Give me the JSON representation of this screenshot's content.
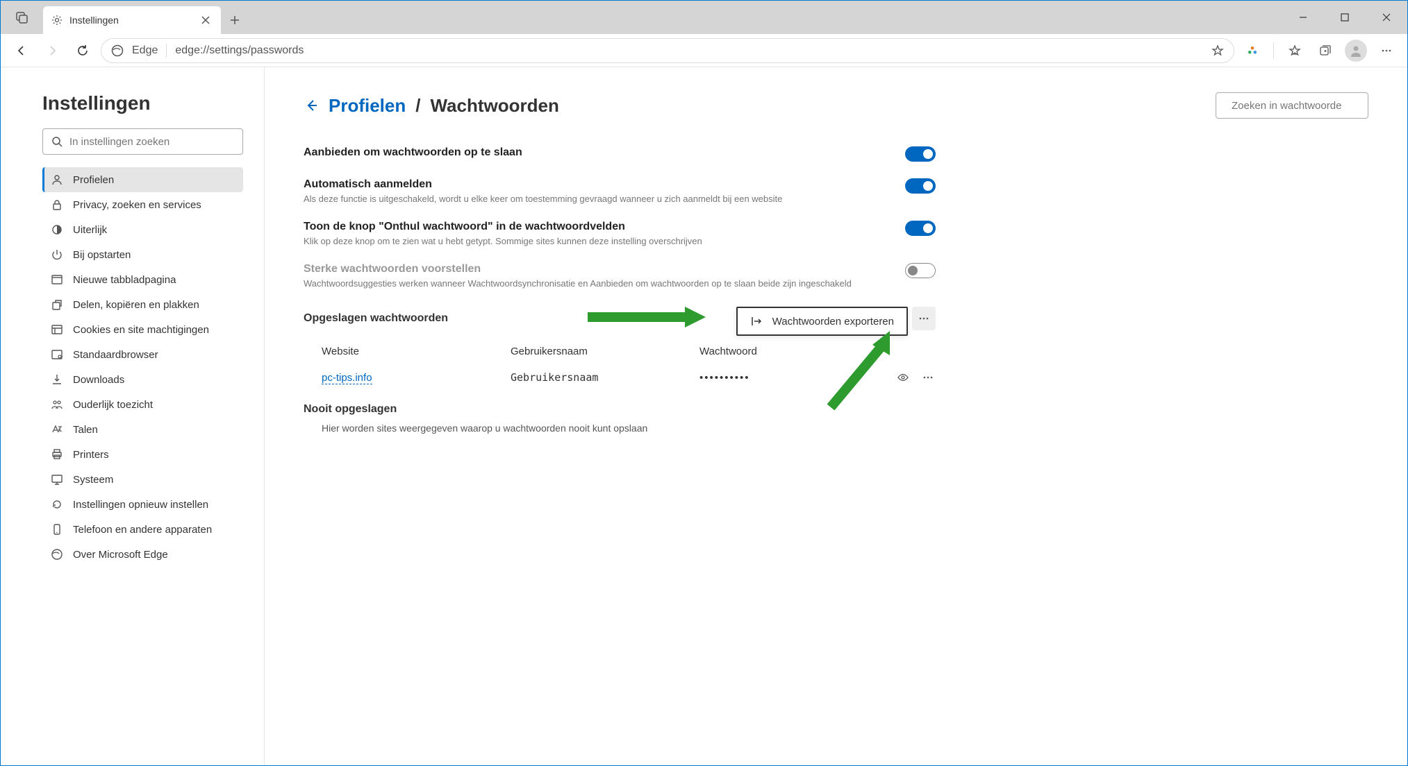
{
  "window": {
    "tab_title": "Instellingen"
  },
  "address": {
    "label": "Edge",
    "url": "edge://settings/passwords"
  },
  "sidebar": {
    "title": "Instellingen",
    "search_placeholder": "In instellingen zoeken",
    "items": [
      {
        "label": "Profielen",
        "icon": "profile"
      },
      {
        "label": "Privacy, zoeken en services",
        "icon": "lock"
      },
      {
        "label": "Uiterlijk",
        "icon": "appearance"
      },
      {
        "label": "Bij opstarten",
        "icon": "power"
      },
      {
        "label": "Nieuwe tabbladpagina",
        "icon": "newtab"
      },
      {
        "label": "Delen, kopiëren en plakken",
        "icon": "share"
      },
      {
        "label": "Cookies en site machtigingen",
        "icon": "cookies"
      },
      {
        "label": "Standaardbrowser",
        "icon": "browser"
      },
      {
        "label": "Downloads",
        "icon": "download"
      },
      {
        "label": "Ouderlijk toezicht",
        "icon": "family"
      },
      {
        "label": "Talen",
        "icon": "language"
      },
      {
        "label": "Printers",
        "icon": "printer"
      },
      {
        "label": "Systeem",
        "icon": "system"
      },
      {
        "label": "Instellingen opnieuw instellen",
        "icon": "reset"
      },
      {
        "label": "Telefoon en andere apparaten",
        "icon": "phone"
      },
      {
        "label": "Over Microsoft Edge",
        "icon": "edge"
      }
    ]
  },
  "breadcrumb": {
    "parent": "Profielen",
    "current": "Wachtwoorden"
  },
  "page_search_placeholder": "Zoeken in wachtwoorde",
  "settings": [
    {
      "title": "Aanbieden om wachtwoorden op te slaan",
      "desc": "",
      "on": true,
      "enabled": true
    },
    {
      "title": "Automatisch aanmelden",
      "desc": "Als deze functie is uitgeschakeld, wordt u elke keer om toestemming gevraagd wanneer u zich aanmeldt bij een website",
      "on": true,
      "enabled": true
    },
    {
      "title": "Toon de knop \"Onthul wachtwoord\" in de wachtwoordvelden",
      "desc": "Klik op deze knop om te zien wat u hebt getypt. Sommige sites kunnen deze instelling overschrijven",
      "on": true,
      "enabled": true
    },
    {
      "title": "Sterke wachtwoorden voorstellen",
      "desc": "Wachtwoordsuggesties werken wanneer Wachtwoordsynchronisatie en Aanbieden om wachtwoorden op te slaan beide zijn ingeschakeld",
      "on": false,
      "enabled": false
    }
  ],
  "saved_section": {
    "title": "Opgeslagen wachtwoorden",
    "export_label": "Wachtwoorden exporteren",
    "cols": {
      "site": "Website",
      "user": "Gebruikersnaam",
      "pass": "Wachtwoord"
    },
    "rows": [
      {
        "site": "pc-tips.info",
        "user": "Gebruikersnaam",
        "pass": "••••••••••"
      }
    ]
  },
  "never_section": {
    "title": "Nooit opgeslagen",
    "desc": "Hier worden sites weergegeven waarop u wachtwoorden nooit kunt opslaan"
  }
}
